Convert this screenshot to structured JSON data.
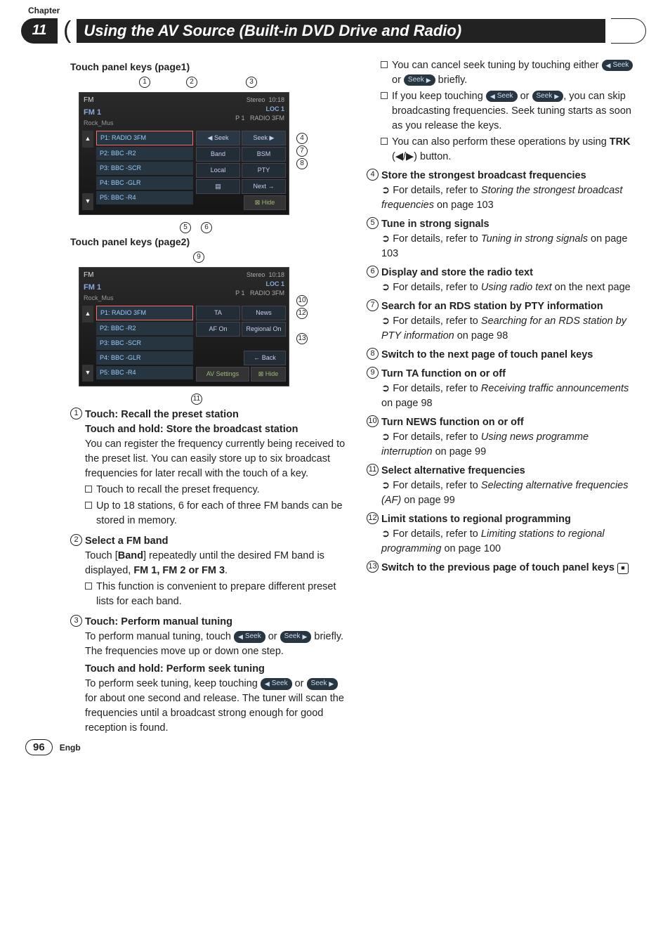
{
  "header": {
    "chapter_label": "Chapter",
    "chapter_number": "11",
    "title": "Using the AV Source (Built-in DVD Drive and Radio)"
  },
  "left_col": {
    "panel1_label": "Touch panel keys (page1)",
    "panel2_label": "Touch panel keys (page2)",
    "panel": {
      "fm": "FM",
      "fm1": "FM 1",
      "rockmus": "Rock_Mus",
      "stereo": "Stereo",
      "time": "10:18",
      "loc": "LOC 1",
      "p1": "P 1",
      "radio3fm": "RADIO 3FM",
      "presets": [
        "P1: RADIO 3FM",
        "P2: BBC -R2",
        "P3: BBC -SCR",
        "P4: BBC -GLR",
        "P5: BBC -R4"
      ],
      "btns_p1": {
        "seek_l": "◀   Seek",
        "seek_r": "Seek   ▶",
        "band": "Band",
        "bsm": "BSM",
        "local": "Local",
        "pty": "PTY",
        "text": "▤",
        "next": "Next  →",
        "hide": "⊠  Hide"
      },
      "btns_p2": {
        "ta": "TA",
        "news": "News",
        "af": "AF On",
        "regional": "Regional On",
        "back": "←  Back",
        "av": "AV Settings",
        "hide": "⊠  Hide"
      }
    },
    "items": {
      "i1": {
        "title": "Touch: Recall the preset station",
        "title2": "Touch and hold: Store the broadcast station",
        "body": "You can register the frequency currently being received to the preset list. You can easily store up to six broadcast frequencies for later recall with the touch of a key.",
        "b1": "Touch to recall the preset frequency.",
        "b2": "Up to 18 stations, 6 for each of three FM bands can be stored in memory."
      },
      "i2": {
        "title": "Select a FM band",
        "body_a": "Touch [",
        "body_b": "Band",
        "body_c": "] repeatedly until the desired FM band is displayed, ",
        "bands": "FM 1, FM 2 or FM 3",
        "body_d": ".",
        "b1": "This function is convenient to prepare different preset lists for each band."
      },
      "i3": {
        "title": "Touch: Perform manual tuning",
        "body_a": "To perform manual tuning, touch ",
        "body_b": " or ",
        "body_c": " briefly. The frequencies move up or down one step.",
        "title2": "Touch and hold: Perform seek tuning",
        "body2_a": "To perform seek tuning, keep touching ",
        "body2_b": " or ",
        "body2_c": " for about one second and release. The tuner will scan the frequencies until a broadcast strong enough for good reception is found."
      }
    }
  },
  "right_col": {
    "top": {
      "b1_a": "You can cancel seek tuning by touching either ",
      "b1_b": " or ",
      "b1_c": " briefly.",
      "b2_a": "If you keep touching ",
      "b2_b": " or ",
      "b2_c": ", you can skip broadcasting frequencies. Seek tuning starts as soon as you release the keys.",
      "b3_a": "You can also perform these operations by using ",
      "b3_trk": "TRK",
      "b3_b": " (◀/▶) button."
    },
    "items": {
      "i4": {
        "title": "Store the strongest broadcast frequencies",
        "ref": "For details, refer to ",
        "ital": "Storing the strongest broadcast frequencies",
        "tail": " on page 103"
      },
      "i5": {
        "title": "Tune in strong signals",
        "ref": "For details, refer to ",
        "ital": "Tuning in strong signals",
        "tail": " on page 103"
      },
      "i6": {
        "title": "Display and store the radio text",
        "ref": "For details, refer to ",
        "ital": "Using radio text",
        "tail": " on the next page"
      },
      "i7": {
        "title": "Search for an RDS station by PTY information",
        "ref": "For details, refer to ",
        "ital": "Searching for an RDS station by PTY information",
        "tail": " on page 98"
      },
      "i8": {
        "title": "Switch to the next page of touch panel keys"
      },
      "i9": {
        "title": "Turn TA function on or off",
        "ref": "For details, refer to ",
        "ital": "Receiving traffic announcements",
        "tail": " on page 98"
      },
      "i10": {
        "title": "Turn NEWS function on or off",
        "ref": "For details, refer to ",
        "ital": "Using news programme interruption",
        "tail": " on page 99"
      },
      "i11": {
        "title": "Select alternative frequencies",
        "ref": "For details, refer to ",
        "ital": "Selecting alternative frequencies (AF)",
        "tail": " on page 99"
      },
      "i12": {
        "title": "Limit stations to regional programming",
        "ref": "For details, refer to ",
        "ital": "Limiting stations to regional programming",
        "tail": " on page 100"
      },
      "i13": {
        "title": "Switch to the previous page of touch panel keys"
      }
    }
  },
  "seek": {
    "left": "◀   Seek",
    "right": "Seek   ▶"
  },
  "callouts": {
    "c1": "1",
    "c2": "2",
    "c3": "3",
    "c4": "4",
    "c5": "5",
    "c6": "6",
    "c7": "7",
    "c8": "8",
    "c9": "9",
    "c10": "10",
    "c11": "11",
    "c12": "12",
    "c13": "13"
  },
  "footer": {
    "page": "96",
    "lang": "Engb"
  },
  "icons": {
    "stop": "■"
  }
}
